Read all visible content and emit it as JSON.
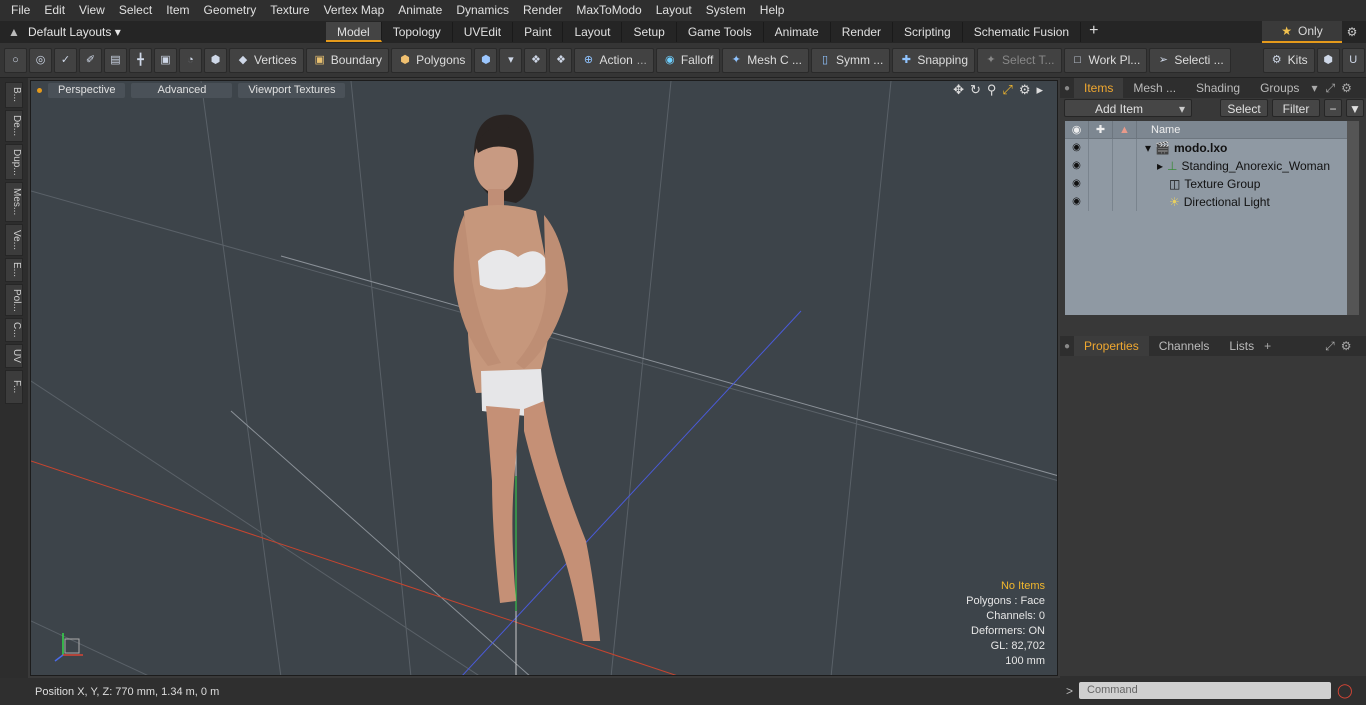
{
  "menu": [
    "File",
    "Edit",
    "View",
    "Select",
    "Item",
    "Geometry",
    "Texture",
    "Vertex Map",
    "Animate",
    "Dynamics",
    "Render",
    "MaxToModo",
    "Layout",
    "System",
    "Help"
  ],
  "layout_selector": "Default Layouts ▾",
  "tabs": [
    "Model",
    "Topology",
    "UVEdit",
    "Paint",
    "Layout",
    "Setup",
    "Game Tools",
    "Animate",
    "Render",
    "Scripting",
    "Schematic Fusion"
  ],
  "active_tab": "Model",
  "only_label": "Only",
  "toolbar": {
    "vertices": "Vertices",
    "boundary": "Boundary",
    "polygons": "Polygons",
    "action": "Action",
    "falloff": "Falloff",
    "mesh_c": "Mesh C ...",
    "symm": "Symm ...",
    "snapping": "Snapping",
    "select_t": "Select T...",
    "work_pl": "Work Pl...",
    "selecti": "Selecti ...",
    "kits": "Kits"
  },
  "left_tabs": [
    "B...",
    "De...",
    "Dup...",
    "Mes...",
    "Ve...",
    "E...",
    "Pol...",
    "C...",
    "UV",
    "F..."
  ],
  "viewport": {
    "perspective": "Perspective",
    "advanced": "Advanced",
    "viewport_textures": "Viewport Textures",
    "info": {
      "no_items": "No Items",
      "polygons": "Polygons : Face",
      "channels": "Channels: 0",
      "deformers": "Deformers: ON",
      "gl": "GL: 82,702",
      "scale": "100 mm"
    }
  },
  "status": "Position X, Y, Z:   770 mm, 1.34 m, 0 m",
  "items_panel": {
    "tabs": [
      "Items",
      "Mesh ...",
      "Shading",
      "Groups"
    ],
    "add_item": "Add Item",
    "select": "Select",
    "filter": "Filter",
    "name_header": "Name",
    "tree": [
      {
        "label": "modo.lxo",
        "bold": true
      },
      {
        "label": "Standing_Anorexic_Woman",
        "bold": false
      },
      {
        "label": "Texture Group",
        "bold": false
      },
      {
        "label": "Directional Light",
        "bold": false
      }
    ]
  },
  "properties_panel": {
    "tabs": [
      "Properties",
      "Channels",
      "Lists"
    ]
  },
  "command_placeholder": "Command",
  "colors": {
    "accent": "#e59a1b",
    "viewport_bg": "#3d444a",
    "tree_bg": "#8f99a3"
  }
}
